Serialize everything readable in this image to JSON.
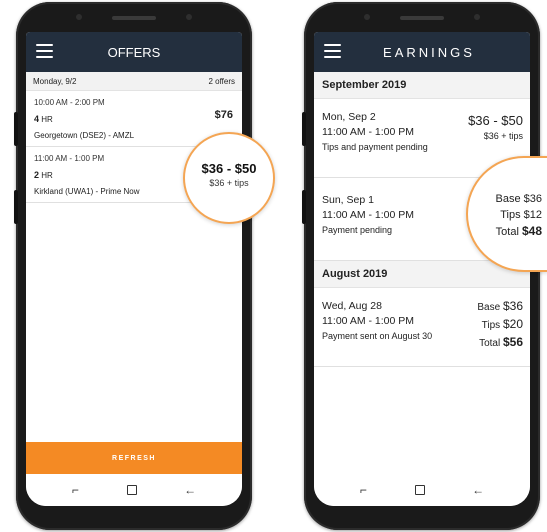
{
  "offers_screen": {
    "title": "OFFERS",
    "date": "Monday, 9/2",
    "offers_count": "2 offers",
    "offers": [
      {
        "time": "10:00 AM - 2:00 PM",
        "duration_value": "4",
        "duration_unit": "HR",
        "location": "Georgetown (DSE2)  - AMZL",
        "price": "$76"
      },
      {
        "time": "11:00 AM - 1:00 PM",
        "duration_value": "2",
        "duration_unit": "HR",
        "location": "Kirkland (UWA1)  -  Prime Now",
        "price": "$36 - $50",
        "price_note": "$36 + tips"
      }
    ],
    "refresh_label": "REFRESH"
  },
  "earnings_screen": {
    "title": "EARNINGS",
    "months": [
      {
        "label": "September 2019",
        "entries": [
          {
            "date": "Mon, Sep 2",
            "time": "11:00 AM - 1:00 PM",
            "status": "Tips and payment pending",
            "range": "$36 - $50",
            "range_note": "$36 + tips"
          },
          {
            "date": "Sun, Sep 1",
            "time": "11:00 AM - 1:00 PM",
            "status": "Payment pending",
            "base_label": "Base",
            "base": "$36",
            "tips_label": "Tips",
            "tips": "$12",
            "total_label": "Total",
            "total": "$48"
          }
        ]
      },
      {
        "label": "August 2019",
        "entries": [
          {
            "date": "Wed, Aug 28",
            "time": "11:00 AM - 1:00 PM",
            "status": "Payment sent on August 30",
            "base_label": "Base",
            "base": "$36",
            "tips_label": "Tips",
            "tips": "$20",
            "total_label": "Total",
            "total": "$56"
          }
        ]
      }
    ]
  },
  "navbar": {
    "recent_icon": "⌐",
    "home_icon": "□",
    "back_icon": "←"
  },
  "colors": {
    "appbar": "#232f3e",
    "refresh": "#f48a24",
    "highlight_ring": "#f4a553"
  }
}
